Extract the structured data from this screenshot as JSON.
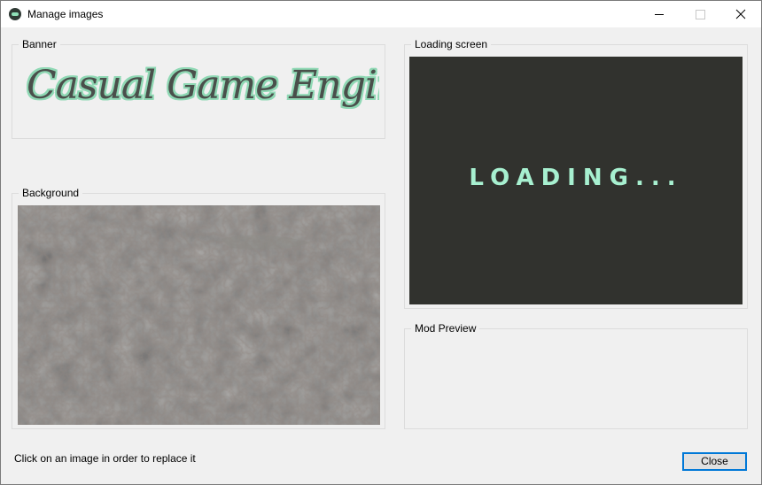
{
  "window": {
    "title": "Manage images",
    "app_icon": "casual-game-engine-icon"
  },
  "title_buttons": {
    "minimize": "minimize-icon",
    "maximize": "maximize-icon",
    "close": "close-icon"
  },
  "groups": {
    "banner": {
      "label": "Banner",
      "image_text": "Casual Game Engine"
    },
    "background": {
      "label": "Background"
    },
    "loading": {
      "label": "Loading screen",
      "image_text": "LOADING..."
    },
    "mod_preview": {
      "label": "Mod Preview"
    }
  },
  "footer": {
    "hint": "Click on an image in order to replace it",
    "close_label": "Close"
  },
  "colors": {
    "accent": "#0078d7",
    "loading_bg": "#31322e",
    "loading_text": "#a7f0d0",
    "banner_text": "#4a4f4b",
    "banner_outline": "#8fd8b4"
  }
}
